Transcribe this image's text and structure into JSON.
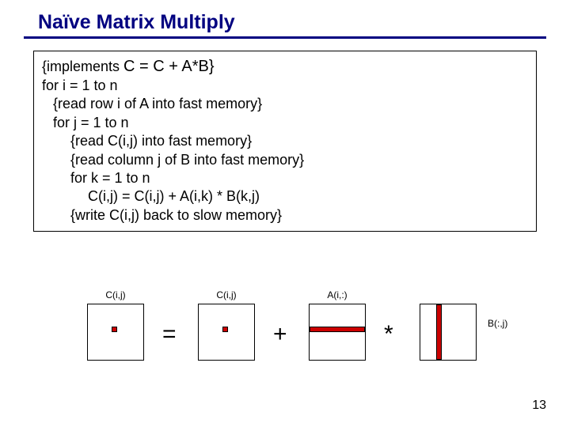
{
  "slide": {
    "title": "Naïve Matrix Multiply",
    "page_number": "13"
  },
  "code": {
    "implements_pre": "{implements ",
    "implements_expr": "C = C + A*B}",
    "l1": "for i = 1 to n",
    "l2": "{read row i of A into fast memory}",
    "l3": "for j = 1 to n",
    "l4": "{read C(i,j) into fast memory}",
    "l5": "{read column j of B into fast memory}",
    "l6": "for k = 1 to n",
    "l7": "C(i,j) = C(i,j) + A(i,k) * B(k,j)",
    "l8": "{write C(i,j) back to slow memory}"
  },
  "diagram": {
    "m1_label": "C(i,j)",
    "op_eq": "=",
    "m2_label": "C(i,j)",
    "op_plus": "+",
    "m3_label": "A(i,:)",
    "op_mul": "*",
    "m4_label": "B(:,j)"
  }
}
